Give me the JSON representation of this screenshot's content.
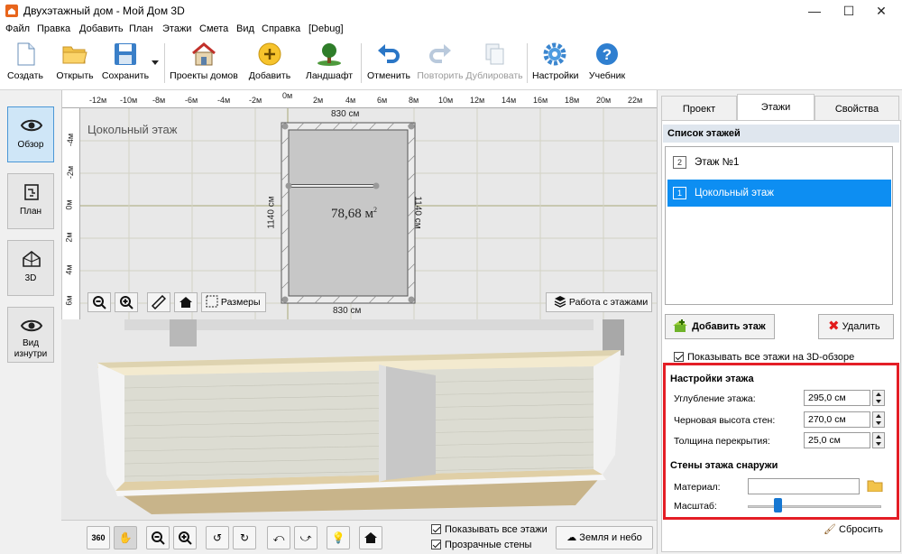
{
  "window": {
    "title": "Двухэтажный дом - Мой Дом 3D",
    "minimize_icon": "minimize-icon",
    "maximize_icon": "maximize-icon",
    "close_icon": "close-icon"
  },
  "menu": [
    "Файл",
    "Правка",
    "Добавить",
    "План",
    "Этажи",
    "Смета",
    "Вид",
    "Справка",
    "[Debug]"
  ],
  "toolbar": {
    "create": "Создать",
    "open": "Открыть",
    "save": "Сохранить",
    "projects": "Проекты домов",
    "add": "Добавить",
    "landscape": "Ландшафт",
    "undo": "Отменить",
    "redo": "Повторить",
    "duplicate": "Дублировать",
    "settings": "Настройки",
    "tutorial": "Учебник"
  },
  "left_nav": {
    "overview": "Обзор",
    "plan": "План",
    "3d": "3D",
    "inside": "Вид изнутри"
  },
  "ruler": {
    "top": [
      "-12м",
      "-10м",
      "-8м",
      "-6м",
      "-4м",
      "-2м",
      "0м",
      "2м",
      "4м",
      "6м",
      "8м",
      "10м",
      "12м",
      "14м",
      "16м",
      "18м",
      "20м",
      "22м"
    ],
    "left": [
      "-4м",
      "-2м",
      "0м",
      "2м",
      "4м",
      "6м"
    ]
  },
  "plan": {
    "floor_label": "Цокольный этаж",
    "dim_top": "830 см",
    "dim_bottom": "830 см",
    "dim_left": "1140 см",
    "dim_right": "1140 см",
    "area": "78,68 м",
    "area_sup": "2",
    "dimensions_btn": "Размеры",
    "work_with_floors_btn": "Работа с этажами"
  },
  "bottom": {
    "show_all_floors": "Показывать все этажи",
    "transparent_walls": "Прозрачные стены",
    "earth_sky": "Земля и небо",
    "btn_360": "360"
  },
  "tabs": [
    "Проект",
    "Этажи",
    "Свойства"
  ],
  "floors_panel": {
    "header": "Список этажей",
    "floors": [
      {
        "num": "2",
        "name": "Этаж №1",
        "selected": false
      },
      {
        "num": "1",
        "name": "Цокольный этаж",
        "selected": true
      }
    ],
    "add_floor": "Добавить этаж",
    "delete": "Удалить",
    "show_all_3d": "Показывать все этажи на 3D-обзоре",
    "settings_header": "Настройки этажа",
    "depth_label": "Углубление этажа:",
    "depth_value": "295,0 см",
    "rough_height_label": "Черновая высота стен:",
    "rough_height_value": "270,0 см",
    "slab_label": "Толщина перекрытия:",
    "slab_value": "25,0 см",
    "outer_walls_header": "Стены этажа снаружи",
    "material_label": "Материал:",
    "material_value": "",
    "scale_label": "Масштаб:",
    "scale_level": 0.22,
    "reset": "Сбросить"
  },
  "colors": {
    "accent": "#0d8ef2",
    "highlight_frame": "#e41e26",
    "header_bg": "#dfe6ee"
  }
}
